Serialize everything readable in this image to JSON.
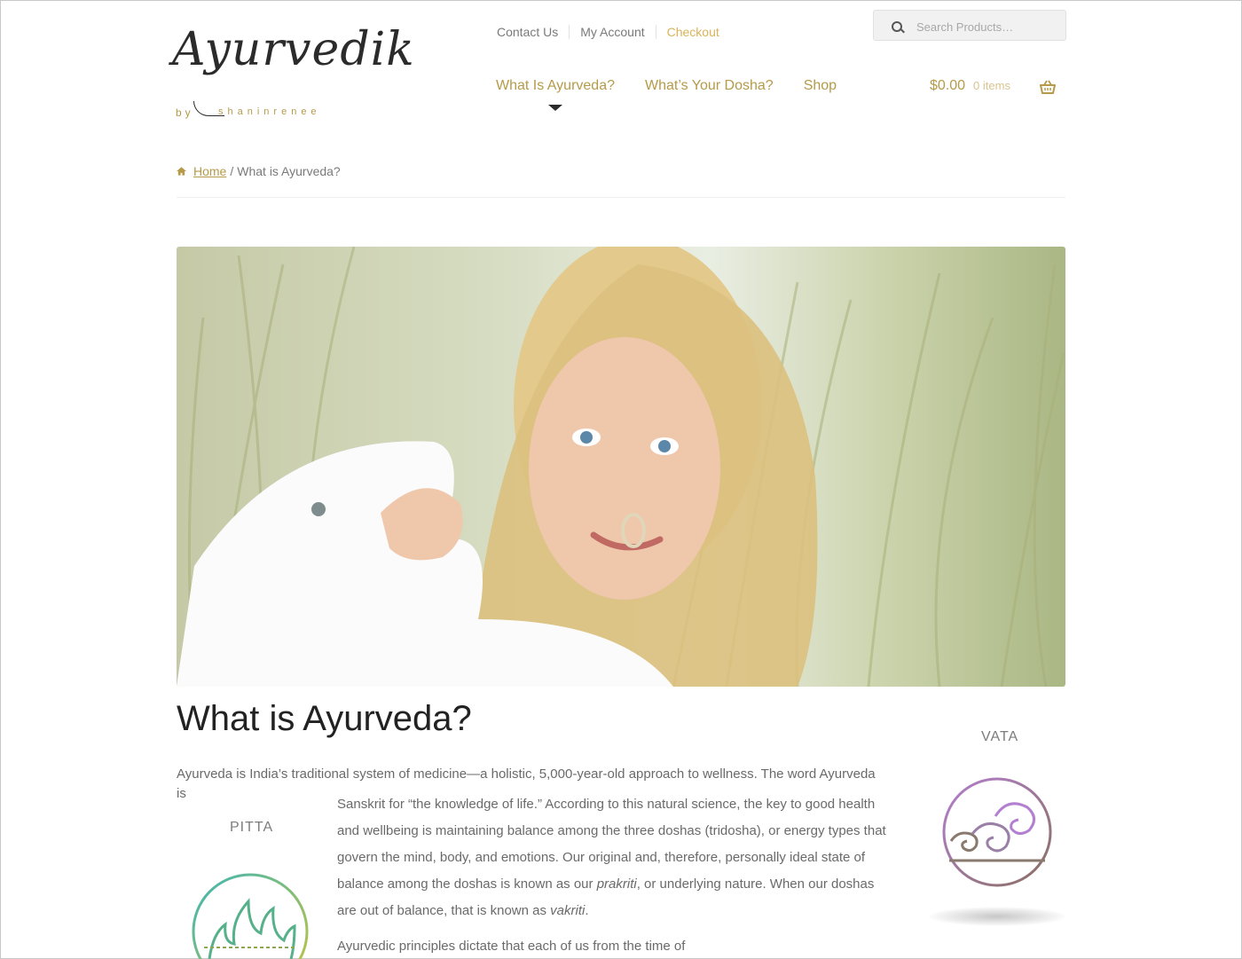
{
  "logo": {
    "script": "Ayurvedik",
    "by": "by",
    "name": "shaninrenee"
  },
  "secondary_nav": {
    "contact": "Contact Us",
    "account": "My Account",
    "checkout": "Checkout"
  },
  "search": {
    "placeholder": "Search Products…"
  },
  "primary_nav": [
    {
      "label": "What Is Ayurveda?",
      "current": true
    },
    {
      "label": "What’s Your Dosha?"
    },
    {
      "label": "Shop"
    }
  ],
  "cart": {
    "amount": "$0.00",
    "count": "0 items"
  },
  "breadcrumb": {
    "home": "Home",
    "separator": "/",
    "current": "What is Ayurveda?"
  },
  "article": {
    "title": "What is Ayurveda?",
    "intro": "Ayurveda is India’s traditional system of medicine—a holistic, 5,000-year-old approach to wellness. The word Ayurveda is",
    "para_a": "Sanskrit for “the knowledge of life.” According to this natural science, the key to good health and wellbeing is maintaining balance among the three doshas (tridosha), or energy types that govern the mind, body, and emotions. Our original and, therefore, personally ideal state of balance among the doshas is known as our ",
    "term1": "prakriti",
    "para_b": ", or underlying nature. When our doshas are out of balance, that is known as ",
    "term2": "vakriti",
    "para_c": ".",
    "para2": "Ayurvedic principles dictate that each of us from the time of"
  },
  "doshas": {
    "vata": "VATA",
    "pitta": "PITTA"
  },
  "colors": {
    "brand_gold": "#b59a49",
    "checkout": "#d9b35a",
    "vata_purple": "#a77bc0",
    "pitta_teal": "#3fb6b4"
  },
  "icons": [
    "search-icon",
    "basket-icon",
    "home-icon",
    "vata-wind-icon",
    "pitta-flame-icon"
  ]
}
